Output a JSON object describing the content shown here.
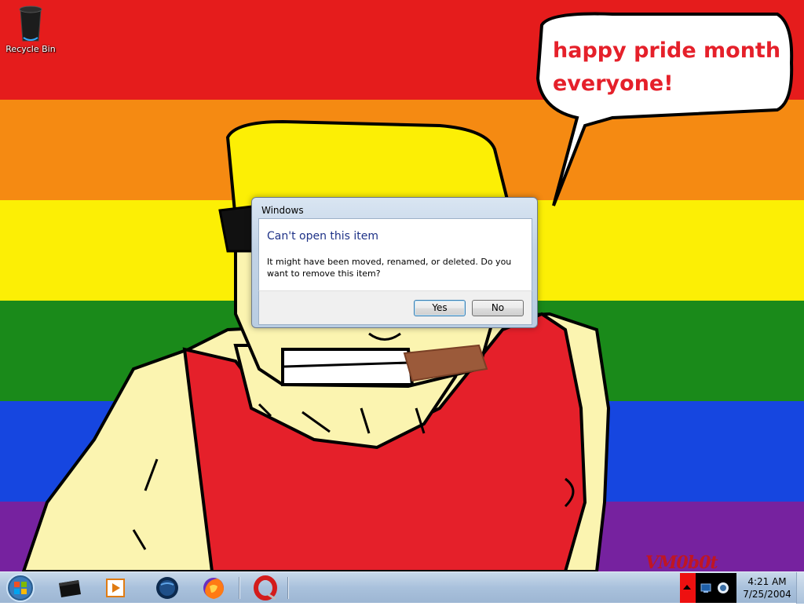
{
  "desktop": {
    "stripes": [
      "#e51c1c",
      "#f58a12",
      "#fcef05",
      "#1a8a1a",
      "#1646e0",
      "#76229f"
    ],
    "icons": [
      {
        "label": "Recycle Bin",
        "icon": "recycle-bin-icon"
      }
    ],
    "speech_bubble": {
      "line1": "happy pride month",
      "line2": "everyone!"
    },
    "watermark": "VM0b0t"
  },
  "dialog": {
    "title": "Windows",
    "heading": "Can't open this item",
    "message": "It might have been moved, renamed, or deleted. Do you want to remove this item?",
    "buttons": {
      "yes": "Yes",
      "no": "No"
    }
  },
  "taskbar": {
    "start_icon": "windows-orb-icon",
    "pinned": [
      {
        "name": "taskbar-computer",
        "icon": "computer-icon"
      },
      {
        "name": "taskbar-media-player",
        "icon": "media-player-icon"
      },
      {
        "name": "taskbar-globe",
        "icon": "globe-icon"
      },
      {
        "name": "taskbar-firefox",
        "icon": "firefox-icon"
      },
      {
        "name": "taskbar-opera",
        "icon": "opera-icon"
      }
    ],
    "clock": {
      "time": "4:21 AM",
      "date": "7/25/2004"
    }
  },
  "colors": {
    "dialog_heading": "#1e3287",
    "speech_text": "#e5202a",
    "tray_red": "#ee1010"
  }
}
